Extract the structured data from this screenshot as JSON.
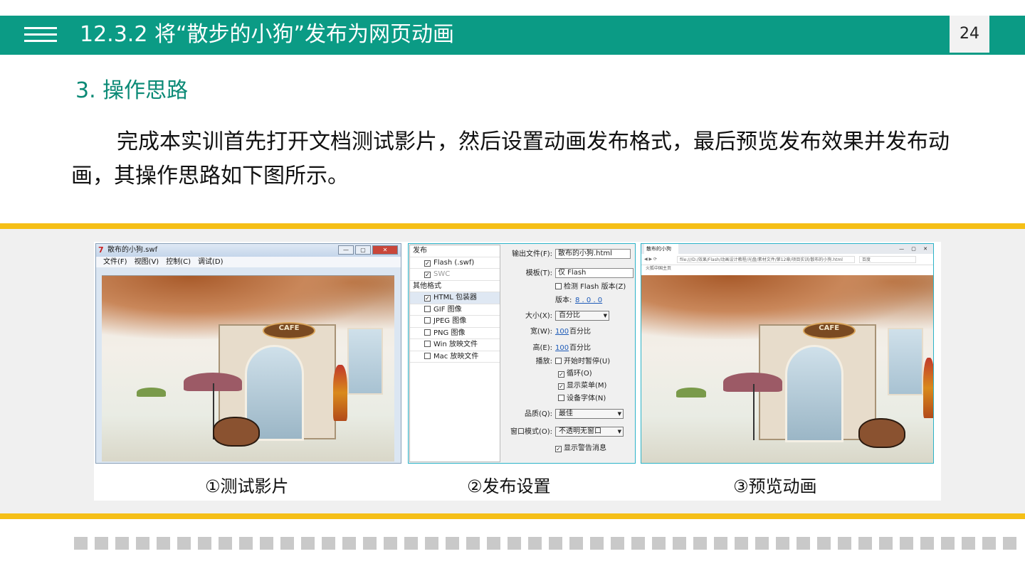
{
  "header": {
    "title": "12.3.2 将“散步的小狗”发布为网页动画",
    "page_number": "24"
  },
  "section": {
    "heading": "3. 操作思路",
    "paragraph": "完成本实训首先打开文档测试影片，然后设置动画发布格式，最后预览发布效果并发布动画，其操作思路如下图所示。"
  },
  "figure": {
    "panel_test": {
      "window_title": "散布的小狗.swf",
      "menu": [
        "文件(F)",
        "视图(V)",
        "控制(C)",
        "调试(D)"
      ],
      "controls": [
        "—",
        "▢",
        "✕"
      ],
      "sign_text": "CAFE"
    },
    "panel_publish": {
      "left_list": [
        {
          "text": "发布",
          "type": "group"
        },
        {
          "text": "Flash (.swf)",
          "type": "item",
          "checked": true
        },
        {
          "text": "SWC",
          "type": "item",
          "checked": true,
          "disabled": true
        },
        {
          "text": "其他格式",
          "type": "group"
        },
        {
          "text": "HTML 包装器",
          "type": "item",
          "checked": true,
          "selected": true
        },
        {
          "text": "GIF 图像",
          "type": "item",
          "checked": false
        },
        {
          "text": "JPEG 图像",
          "type": "item",
          "checked": false
        },
        {
          "text": "PNG 图像",
          "type": "item",
          "checked": false
        },
        {
          "text": "Win 放映文件",
          "type": "item",
          "checked": false
        },
        {
          "text": "Mac 放映文件",
          "type": "item",
          "checked": false
        }
      ],
      "output_label": "输出文件(F):",
      "output_value": "散布的小狗.html",
      "template_label": "模板(T):",
      "template_value": "仅 Flash",
      "detect_flash": "检测 Flash 版本(Z)",
      "version_label": "版本:",
      "version_value": "8 . 0 . 0",
      "size_label": "大小(X):",
      "size_value": "百分比",
      "width_label": "宽(W):",
      "width_value": "100",
      "width_unit": "百分比",
      "height_label": "高(E):",
      "height_value": "100",
      "height_unit": "百分比",
      "playback_label": "播放:",
      "pause_at_start": "开始时暂停(U)",
      "loop": "循环(O)",
      "show_menu": "显示菜单(M)",
      "device_font": "设备字体(N)",
      "quality_label": "品质(Q):",
      "quality_value": "最佳",
      "window_mode_label": "窗口模式(O):",
      "window_mode_value": "不透明无窗口",
      "show_warnings": "显示警告消息"
    },
    "panel_preview": {
      "tab_title": "散布的小狗",
      "address": "file:///D:/效果/Flash/动画设计教程/光盘/素材文件/第12章/项目实训/散布的小狗.html",
      "search_placeholder": "百度",
      "favorites": "火狐中国主页",
      "sign_text": "CAFE"
    },
    "captions": [
      "①测试影片",
      "②发布设置",
      "③预览动画"
    ]
  },
  "colors": {
    "header_teal": "#0b9b85",
    "heading_teal": "#0b8a76",
    "accent_yellow": "#f5bf17",
    "dash_gray": "#c9c9c9"
  }
}
